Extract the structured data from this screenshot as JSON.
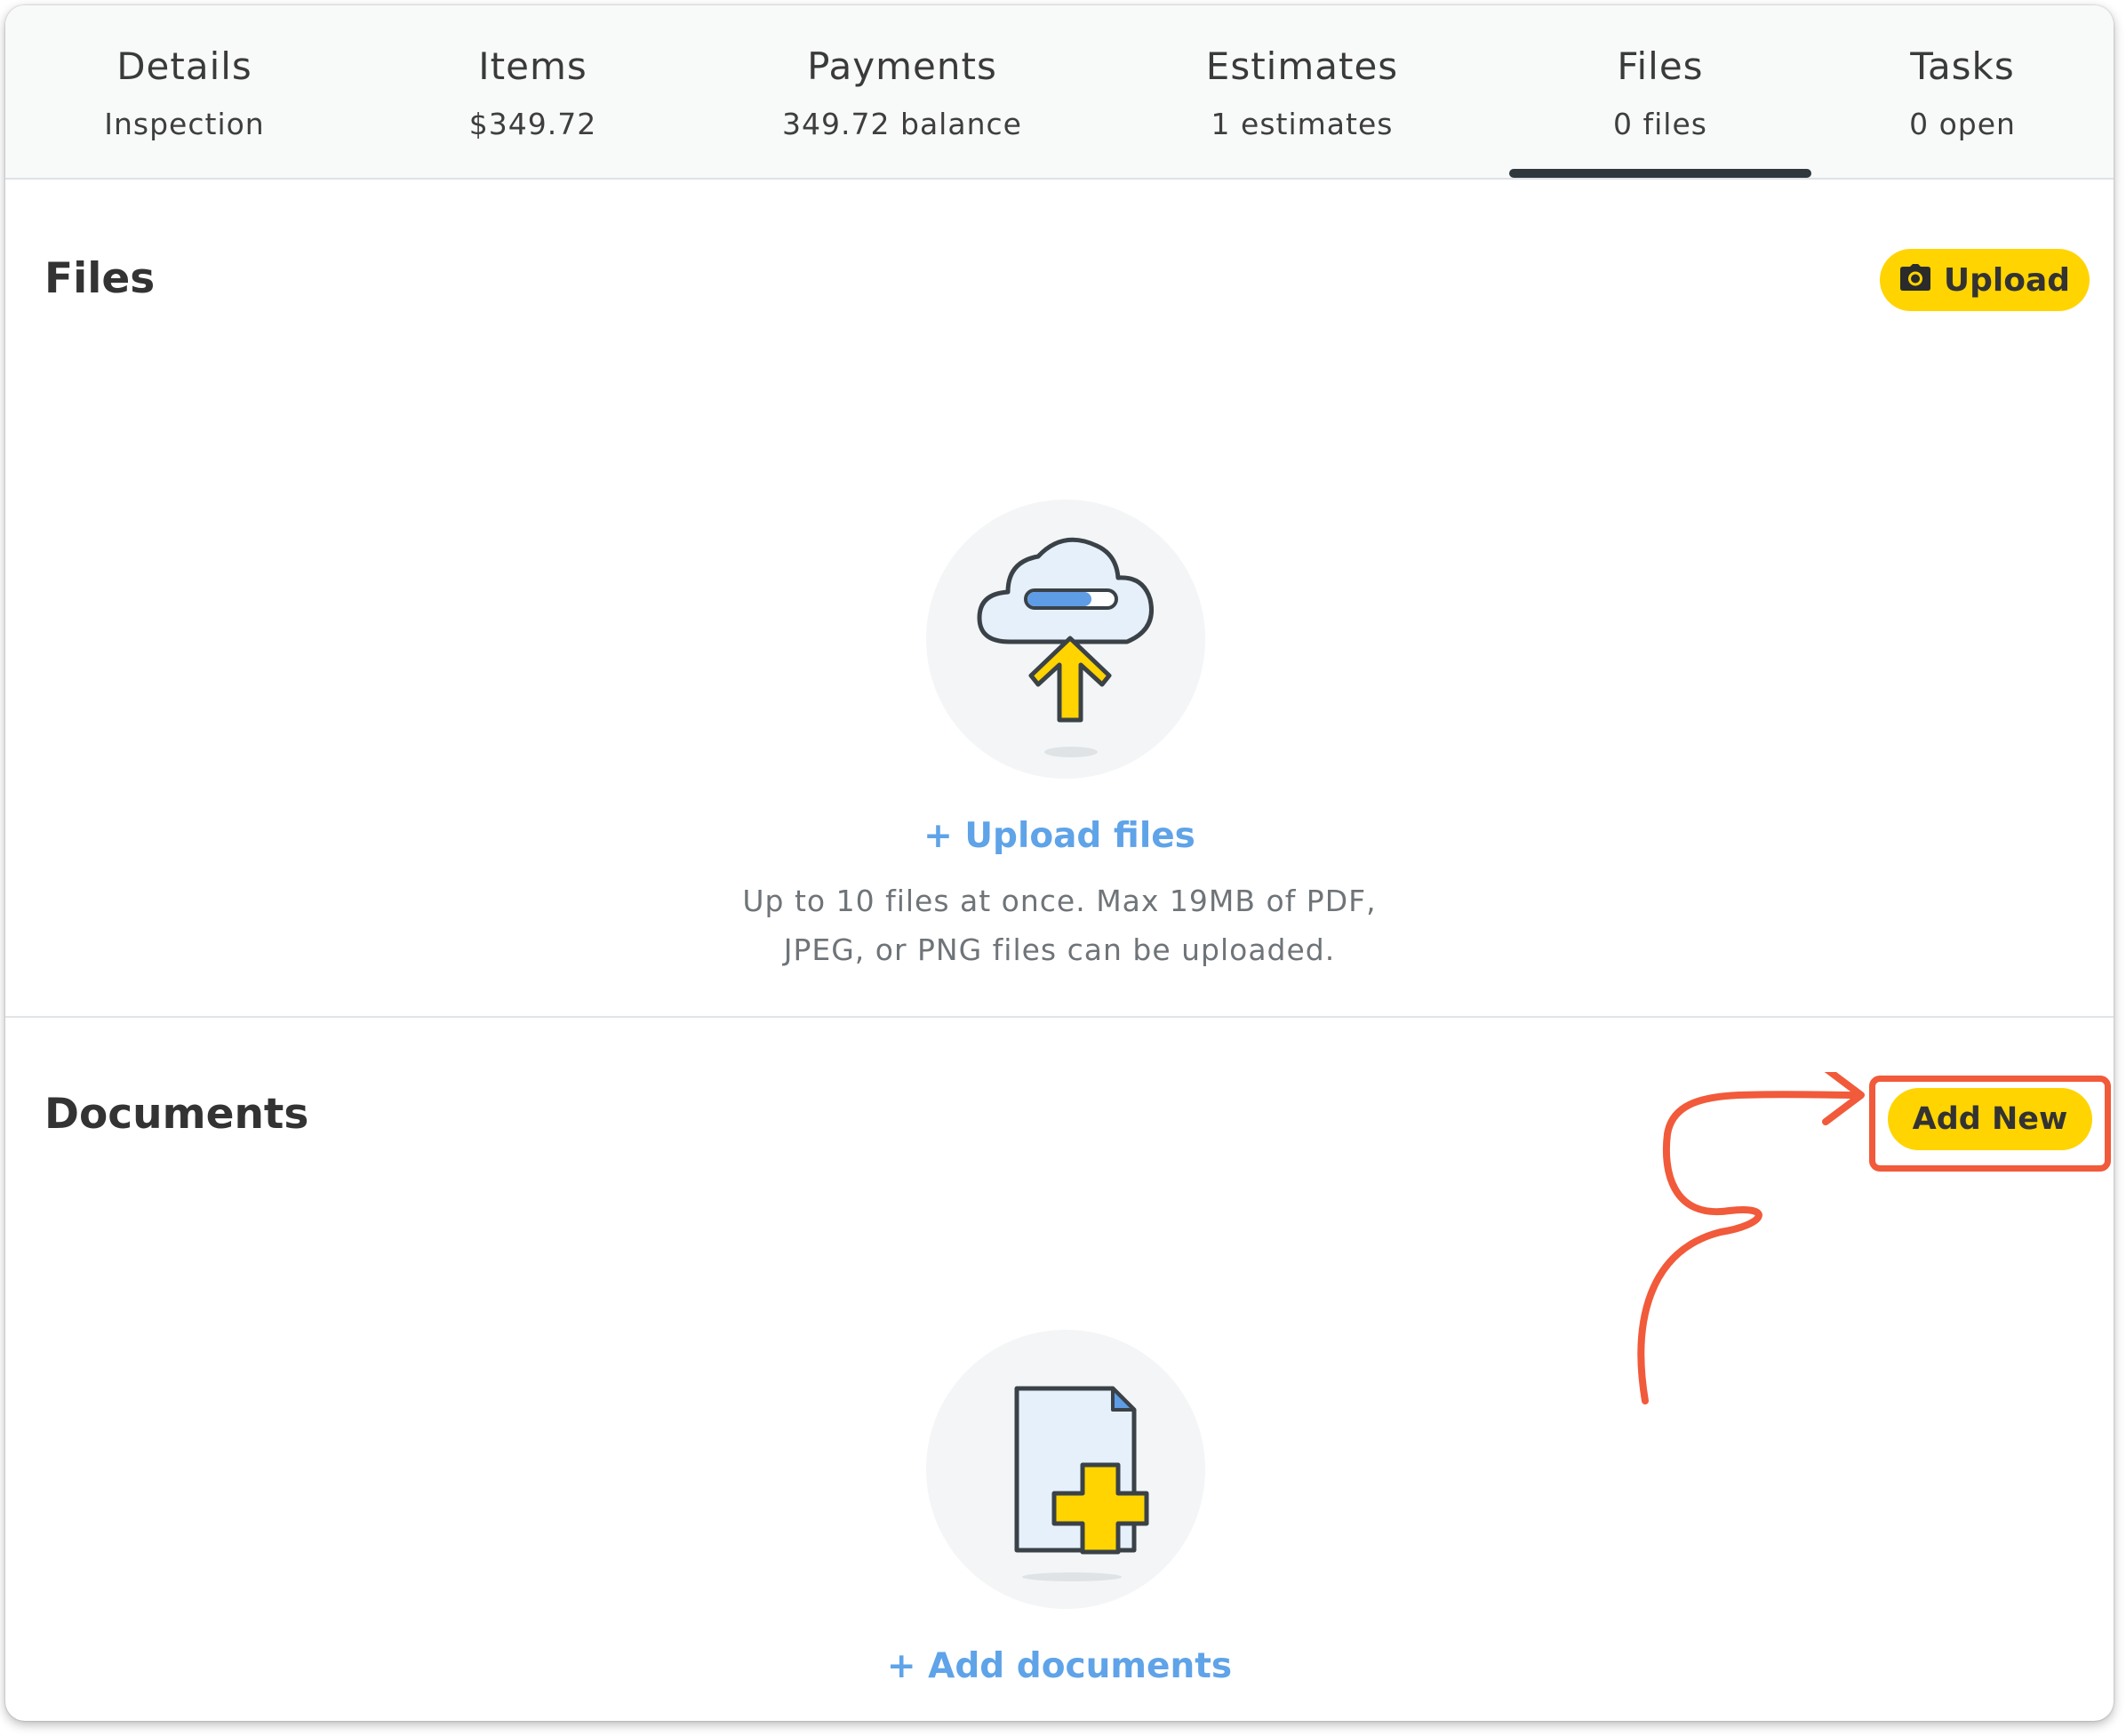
{
  "tabs": [
    {
      "title": "Details",
      "subtitle": "Inspection"
    },
    {
      "title": "Items",
      "subtitle": "$349.72"
    },
    {
      "title": "Payments",
      "subtitle": "349.72 balance"
    },
    {
      "title": "Estimates",
      "subtitle": "1 estimates"
    },
    {
      "title": "Files",
      "subtitle": "0 files"
    },
    {
      "title": "Tasks",
      "subtitle": "0 open"
    }
  ],
  "active_tab": "Files",
  "files_section": {
    "title": "Files",
    "upload_button_label": "Upload",
    "upload_icon": "camera-icon",
    "empty_illustration": "cloud-upload-icon",
    "upload_link": "+ Upload files",
    "help_line_1": "Up to 10 files at once. Max 19MB of PDF,",
    "help_line_2": "JPEG, or PNG files can be uploaded."
  },
  "documents_section": {
    "title": "Documents",
    "add_button_label": "Add New",
    "empty_illustration": "document-add-icon",
    "add_link": "+ Add documents"
  },
  "colors": {
    "accent": "#ffd400",
    "link": "#5fa3e8",
    "annotation": "#f15a3a",
    "tab_indicator": "#2f383d"
  }
}
